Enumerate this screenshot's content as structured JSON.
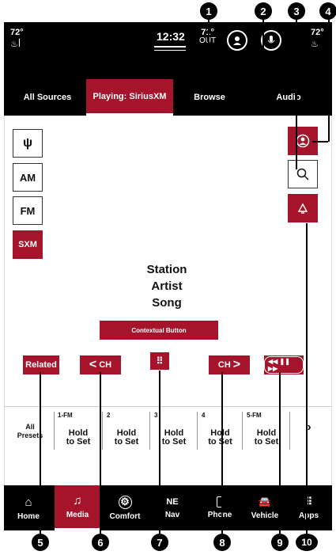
{
  "status": {
    "left_temp": "72°",
    "clock": "12:32",
    "outside_temp": "71°",
    "outside_label": "OUT",
    "right_temp": "72°"
  },
  "tabs": [
    {
      "label": "All Sources"
    },
    {
      "label": "Playing: SiriusXM",
      "active": true
    },
    {
      "label": "Browse"
    },
    {
      "label": "Audio"
    }
  ],
  "sources": [
    {
      "label": "",
      "icon": "usb-icon"
    },
    {
      "label": "AM"
    },
    {
      "label": "FM"
    },
    {
      "label": "SXM",
      "active": true
    }
  ],
  "now_playing": {
    "station": "Station",
    "artist": "Artist",
    "song": "Song"
  },
  "contextual_button": "Contextual Button",
  "controls": {
    "related": "Related",
    "ch_down": "CH",
    "ch_up": "CH"
  },
  "presets": {
    "all_label_1": "All",
    "all_label_2": "Presets",
    "items": [
      {
        "num": "1-FM",
        "line1": "Hold",
        "line2": "to Set"
      },
      {
        "num": "2",
        "line1": "Hold",
        "line2": "to Set"
      },
      {
        "num": "3",
        "line1": "Hold",
        "line2": "to Set"
      },
      {
        "num": "4",
        "line1": "Hold",
        "line2": "to Set"
      },
      {
        "num": "5-FM",
        "line1": "Hold",
        "line2": "to Set"
      }
    ],
    "next": "›"
  },
  "nav": [
    {
      "label": "Home",
      "icon": "home-icon"
    },
    {
      "label": "Media",
      "icon": "music-note-icon",
      "active": true
    },
    {
      "label": "Comfort",
      "icon": "comfort-icon"
    },
    {
      "label": "Nav",
      "icon": "compass-icon",
      "extra": "NE"
    },
    {
      "label": "Phone",
      "icon": "phone-icon"
    },
    {
      "label": "Vehicle",
      "icon": "car-icon"
    },
    {
      "label": "Apps",
      "icon": "apps-grid-icon"
    }
  ],
  "callouts": [
    "1",
    "2",
    "3",
    "4",
    "5",
    "6",
    "7",
    "8",
    "9",
    "10"
  ],
  "colors": {
    "accent": "#a5142a",
    "bar": "#000000"
  }
}
